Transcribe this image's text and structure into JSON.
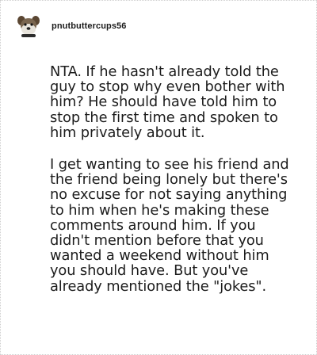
{
  "post": {
    "username": "pnutbuttercups56",
    "avatar_icon": "dog-avatar-icon",
    "paragraphs": [
      "NTA. If he hasn't already told the guy to stop why even bother with him? He should have told him to stop the first time and spoken to him privately about it.",
      "I get wanting to see his friend and the friend being lonely but there's no excuse for not saying anything to him when he's making these comments around him. If you didn't mention before that you wanted a weekend without him you should have. But you've already mentioned the \"jokes\"."
    ]
  },
  "colors": {
    "text": "#1c1c1c",
    "border": "#cfcfcf",
    "background": "#ffffff"
  }
}
